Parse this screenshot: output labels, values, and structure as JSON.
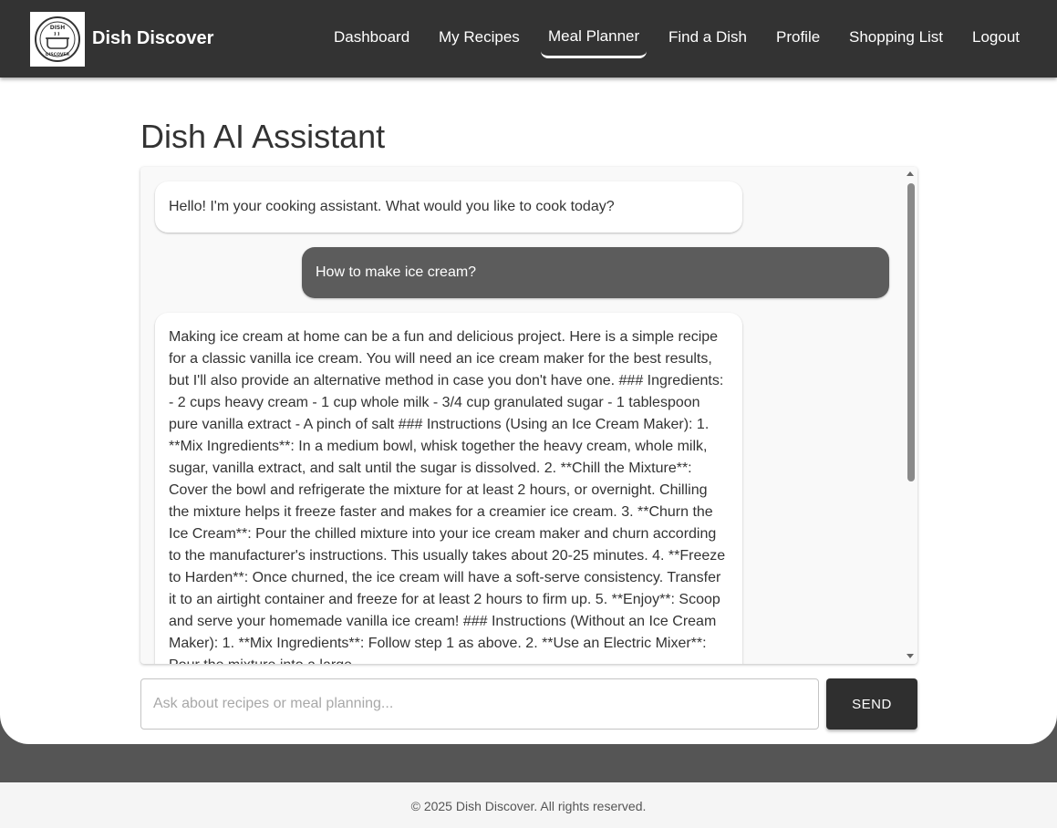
{
  "brand": {
    "name": "Dish Discover",
    "logo_text_top": "DISH",
    "logo_text_bottom": "DISCOVER"
  },
  "nav": {
    "items": [
      {
        "label": "Dashboard"
      },
      {
        "label": "My Recipes"
      },
      {
        "label": "Meal Planner",
        "active": true
      },
      {
        "label": "Find a Dish"
      },
      {
        "label": "Profile"
      },
      {
        "label": "Shopping List"
      },
      {
        "label": "Logout"
      }
    ]
  },
  "page": {
    "title": "Dish AI Assistant"
  },
  "chat": {
    "messages": [
      {
        "role": "assistant",
        "text": "Hello! I'm your cooking assistant. What would you like to cook today?"
      },
      {
        "role": "user",
        "text": "How to make ice cream?"
      },
      {
        "role": "assistant",
        "text": "Making ice cream at home can be a fun and delicious project. Here is a simple recipe for a classic vanilla ice cream. You will need an ice cream maker for the best results, but I'll also provide an alternative method in case you don't have one. ### Ingredients: - 2 cups heavy cream - 1 cup whole milk - 3/4 cup granulated sugar - 1 tablespoon pure vanilla extract - A pinch of salt ### Instructions (Using an Ice Cream Maker): 1. **Mix Ingredients**: In a medium bowl, whisk together the heavy cream, whole milk, sugar, vanilla extract, and salt until the sugar is dissolved. 2. **Chill the Mixture**: Cover the bowl and refrigerate the mixture for at least 2 hours, or overnight. Chilling the mixture helps it freeze faster and makes for a creamier ice cream. 3. **Churn the Ice Cream**: Pour the chilled mixture into your ice cream maker and churn according to the manufacturer's instructions. This usually takes about 20-25 minutes. 4. **Freeze to Harden**: Once churned, the ice cream will have a soft-serve consistency. Transfer it to an airtight container and freeze for at least 2 hours to firm up. 5. **Enjoy**: Scoop and serve your homemade vanilla ice cream! ### Instructions (Without an Ice Cream Maker): 1. **Mix Ingredients**: Follow step 1 as above. 2. **Use an Electric Mixer**: Pour the mixture into a large"
      }
    ],
    "input_placeholder": "Ask about recipes or meal planning...",
    "input_value": "",
    "send_label": "SEND"
  },
  "footer": {
    "text": "© 2025 Dish Discover. All rights reserved."
  },
  "colors": {
    "navbar": "#333333",
    "page_bg": "#555555",
    "user_bubble": "#5c5c5c",
    "send_button": "#2f2f2f",
    "footer_bg": "#f5f5f5"
  }
}
